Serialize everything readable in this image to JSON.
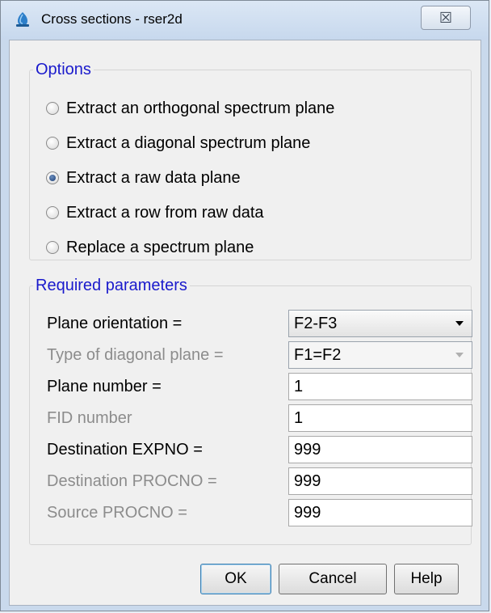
{
  "window": {
    "title": "Cross sections - rser2d",
    "close_label": "☒"
  },
  "options": {
    "legend": "Options",
    "items": [
      {
        "label": "Extract an orthogonal spectrum plane",
        "selected": false
      },
      {
        "label": "Extract a diagonal spectrum plane",
        "selected": false
      },
      {
        "label": "Extract a raw data plane",
        "selected": true
      },
      {
        "label": "Extract a row from raw data",
        "selected": false
      },
      {
        "label": "Replace a spectrum plane",
        "selected": false
      }
    ]
  },
  "params": {
    "legend": "Required parameters",
    "rows": [
      {
        "label": "Plane orientation =",
        "value": "F2-F3",
        "enabled": true,
        "type": "select"
      },
      {
        "label": "Type of diagonal plane =",
        "value": "F1=F2",
        "enabled": false,
        "type": "select"
      },
      {
        "label": "Plane number =",
        "value": "1",
        "enabled": true,
        "type": "input"
      },
      {
        "label": "FID number",
        "value": "1",
        "enabled": false,
        "type": "input"
      },
      {
        "label": "Destination EXPNO =",
        "value": "999",
        "enabled": true,
        "type": "input"
      },
      {
        "label": "Destination PROCNO =",
        "value": "999",
        "enabled": false,
        "type": "input"
      },
      {
        "label": "Source PROCNO =",
        "value": "999",
        "enabled": false,
        "type": "input"
      }
    ]
  },
  "buttons": {
    "ok": "OK",
    "cancel": "Cancel",
    "help": "Help"
  },
  "icons": {
    "title": "topspin-app-icon",
    "close": "close-icon"
  }
}
